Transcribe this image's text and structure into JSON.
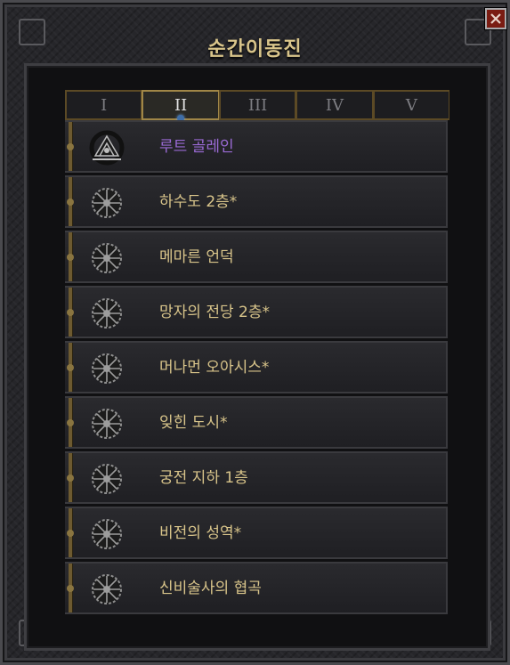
{
  "window": {
    "title": "순간이동진"
  },
  "tabs": [
    {
      "label": "I",
      "active": false
    },
    {
      "label": "II",
      "active": true
    },
    {
      "label": "III",
      "active": false
    },
    {
      "label": "IV",
      "active": false
    },
    {
      "label": "V",
      "active": false
    }
  ],
  "waypoints": [
    {
      "label": "루트 골레인",
      "current": true,
      "icon": "town-sigil-icon"
    },
    {
      "label": "하수도 2층*",
      "current": false,
      "icon": "waypoint-sigil-icon"
    },
    {
      "label": "메마른 언덕",
      "current": false,
      "icon": "waypoint-sigil-icon"
    },
    {
      "label": "망자의 전당 2층*",
      "current": false,
      "icon": "waypoint-sigil-icon"
    },
    {
      "label": "머나먼 오아시스*",
      "current": false,
      "icon": "waypoint-sigil-icon"
    },
    {
      "label": "잊힌 도시*",
      "current": false,
      "icon": "waypoint-sigil-icon"
    },
    {
      "label": "궁전 지하 1층",
      "current": false,
      "icon": "waypoint-sigil-icon"
    },
    {
      "label": "비전의 성역*",
      "current": false,
      "icon": "waypoint-sigil-icon"
    },
    {
      "label": "신비술사의 협곡",
      "current": false,
      "icon": "waypoint-sigil-icon"
    }
  ],
  "colors": {
    "gold_text": "#d8c48a",
    "current_text": "#9a6ad4",
    "close_button": "#7a1c12"
  }
}
